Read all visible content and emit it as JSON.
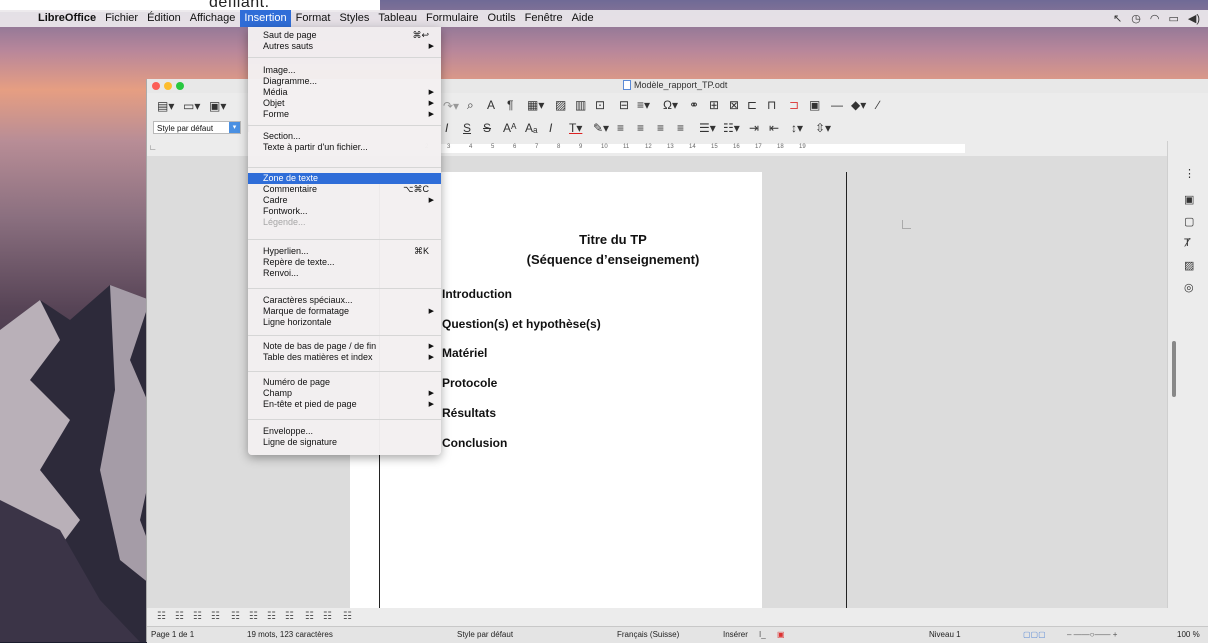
{
  "page_fragment": "défilant.",
  "menubar": {
    "app": "LibreOffice",
    "items": [
      "Fichier",
      "Édition",
      "Affichage",
      "Insertion",
      "Format",
      "Styles",
      "Tableau",
      "Formulaire",
      "Outils",
      "Fenêtre",
      "Aide"
    ],
    "active": "Insertion"
  },
  "window": {
    "title": "Modèle_rapport_TP.odt"
  },
  "toolbar": {
    "para_style": "Style par défaut"
  },
  "ruler": {
    "ticks": [
      "2",
      "3",
      "4",
      "5",
      "6",
      "7",
      "8",
      "9",
      "10",
      "11",
      "12",
      "13",
      "14",
      "15",
      "16",
      "17",
      "18",
      "19"
    ]
  },
  "document": {
    "title": "Titre du TP",
    "subtitle": "(Séquence d’enseignement)",
    "headings": [
      "Introduction",
      "Question(s) et hypothèse(s)",
      "Matériel",
      "Protocole",
      "Résultats",
      "Conclusion"
    ]
  },
  "insert_menu": {
    "items": [
      {
        "label": "Saut de page",
        "shortcut": "⌘↩"
      },
      {
        "label": "Autres sauts",
        "submenu": true
      },
      {
        "label": "Image..."
      },
      {
        "label": "Diagramme..."
      },
      {
        "label": "Média",
        "submenu": true
      },
      {
        "label": "Objet",
        "submenu": true
      },
      {
        "label": "Forme",
        "submenu": true
      },
      {
        "label": "Section..."
      },
      {
        "label": "Texte à partir d'un fichier..."
      },
      {
        "label": "Zone de texte",
        "highlighted": true
      },
      {
        "label": "Commentaire",
        "shortcut": "⌥⌘C"
      },
      {
        "label": "Cadre",
        "submenu": true
      },
      {
        "label": "Fontwork..."
      },
      {
        "label": "Légende...",
        "disabled": true
      },
      {
        "label": "Hyperlien...",
        "shortcut": "⌘K"
      },
      {
        "label": "Repère de texte..."
      },
      {
        "label": "Renvoi..."
      },
      {
        "label": "Caractères spéciaux..."
      },
      {
        "label": "Marque de formatage",
        "submenu": true
      },
      {
        "label": "Ligne horizontale"
      },
      {
        "label": "Note de bas de page / de fin",
        "submenu": true
      },
      {
        "label": "Table des matières et index",
        "submenu": true
      },
      {
        "label": "Numéro de page"
      },
      {
        "label": "Champ",
        "submenu": true
      },
      {
        "label": "En-tête et pied de page",
        "submenu": true
      },
      {
        "label": "Enveloppe..."
      },
      {
        "label": "Ligne de signature"
      }
    ]
  },
  "statusbar": {
    "page": "Page 1 de 1",
    "words": "19 mots, 123 caractères",
    "page_style": "Style par défaut",
    "language": "Français (Suisse)",
    "mode": "Insérer",
    "level": "Niveau 1",
    "zoom": "100 %"
  },
  "colors": {
    "accent": "#2f6dd8"
  }
}
